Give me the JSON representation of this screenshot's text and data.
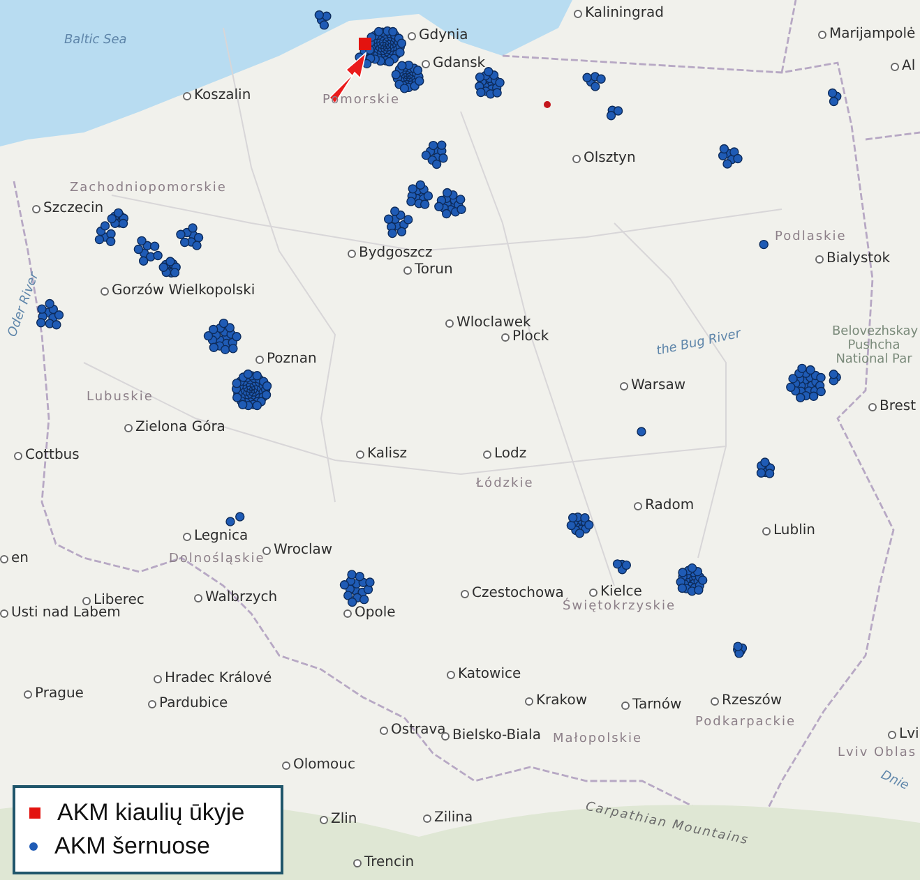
{
  "map": {
    "labels": [
      {
        "text": "Baltic Sea",
        "kind": "water"
      },
      {
        "text": "Kaliningrad",
        "kind": "city"
      },
      {
        "text": "Gdynia",
        "kind": "city"
      },
      {
        "text": "Gdansk",
        "kind": "city"
      },
      {
        "text": "Koszalin",
        "kind": "city"
      },
      {
        "text": "Pomorskie",
        "kind": "region"
      },
      {
        "text": "Marijampolė",
        "kind": "city"
      },
      {
        "text": "Al",
        "kind": "city"
      },
      {
        "text": "Olsztyn",
        "kind": "city"
      },
      {
        "text": "Zachodniopomorskie",
        "kind": "region"
      },
      {
        "text": "Szczecin",
        "kind": "city"
      },
      {
        "text": "Podlaskie",
        "kind": "region"
      },
      {
        "text": "Bialystok",
        "kind": "city"
      },
      {
        "text": "Bydgoszcz",
        "kind": "city"
      },
      {
        "text": "Torun",
        "kind": "city"
      },
      {
        "text": "Gorzów Wielkopolski",
        "kind": "city"
      },
      {
        "text": "Wloclawek",
        "kind": "city"
      },
      {
        "text": "Plock",
        "kind": "city"
      },
      {
        "text": "the Bug River",
        "kind": "water"
      },
      {
        "text": "Belovezhskay Pushcha National Par",
        "kind": "park"
      },
      {
        "text": "Warsaw",
        "kind": "city"
      },
      {
        "text": "Poznan",
        "kind": "city"
      },
      {
        "text": "Lubuskie",
        "kind": "region"
      },
      {
        "text": "Brest",
        "kind": "city"
      },
      {
        "text": "Zielona Góra",
        "kind": "city"
      },
      {
        "text": "Cottbus",
        "kind": "city"
      },
      {
        "text": "Kalisz",
        "kind": "city"
      },
      {
        "text": "Lodz",
        "kind": "city"
      },
      {
        "text": "Łódzkie",
        "kind": "region"
      },
      {
        "text": "Radom",
        "kind": "city"
      },
      {
        "text": "Lublin",
        "kind": "city"
      },
      {
        "text": "en",
        "kind": "city"
      },
      {
        "text": "Legnica",
        "kind": "city"
      },
      {
        "text": "Wroclaw",
        "kind": "city"
      },
      {
        "text": "Dolnośląskie",
        "kind": "region"
      },
      {
        "text": "Liberec",
        "kind": "city"
      },
      {
        "text": "Usti nad Labem",
        "kind": "city"
      },
      {
        "text": "Walbrzych",
        "kind": "city"
      },
      {
        "text": "Opole",
        "kind": "city"
      },
      {
        "text": "Czestochowa",
        "kind": "city"
      },
      {
        "text": "Kielce",
        "kind": "city"
      },
      {
        "text": "Świętokrzyskie",
        "kind": "region"
      },
      {
        "text": "Katowice",
        "kind": "city"
      },
      {
        "text": "Hradec Králové",
        "kind": "city"
      },
      {
        "text": "Prague",
        "kind": "city"
      },
      {
        "text": "Pardubice",
        "kind": "city"
      },
      {
        "text": "Krakow",
        "kind": "city"
      },
      {
        "text": "Tarnów",
        "kind": "city"
      },
      {
        "text": "Rzeszów",
        "kind": "city"
      },
      {
        "text": "Podkarpackie",
        "kind": "region"
      },
      {
        "text": "Ostrava",
        "kind": "city"
      },
      {
        "text": "Bielsko-Biala",
        "kind": "city"
      },
      {
        "text": "Małopolskie",
        "kind": "region"
      },
      {
        "text": "Lvi",
        "kind": "city"
      },
      {
        "text": "Lviv Oblas",
        "kind": "region"
      },
      {
        "text": "Olomouc",
        "kind": "city"
      },
      {
        "text": "Zlin",
        "kind": "city"
      },
      {
        "text": "Zilina",
        "kind": "city"
      },
      {
        "text": "Trencin",
        "kind": "city"
      },
      {
        "text": "Carpathian Mountains",
        "kind": "mountain"
      },
      {
        "text": "Dnie",
        "kind": "water"
      },
      {
        "text": "Oder River",
        "kind": "water"
      }
    ]
  },
  "legend": {
    "items": [
      {
        "label": "AKM kiaulių ūkyje",
        "kind": "square",
        "color": "#e3130f"
      },
      {
        "label": "AKM šernuose",
        "kind": "circle",
        "color": "#1f5bb5"
      }
    ]
  }
}
